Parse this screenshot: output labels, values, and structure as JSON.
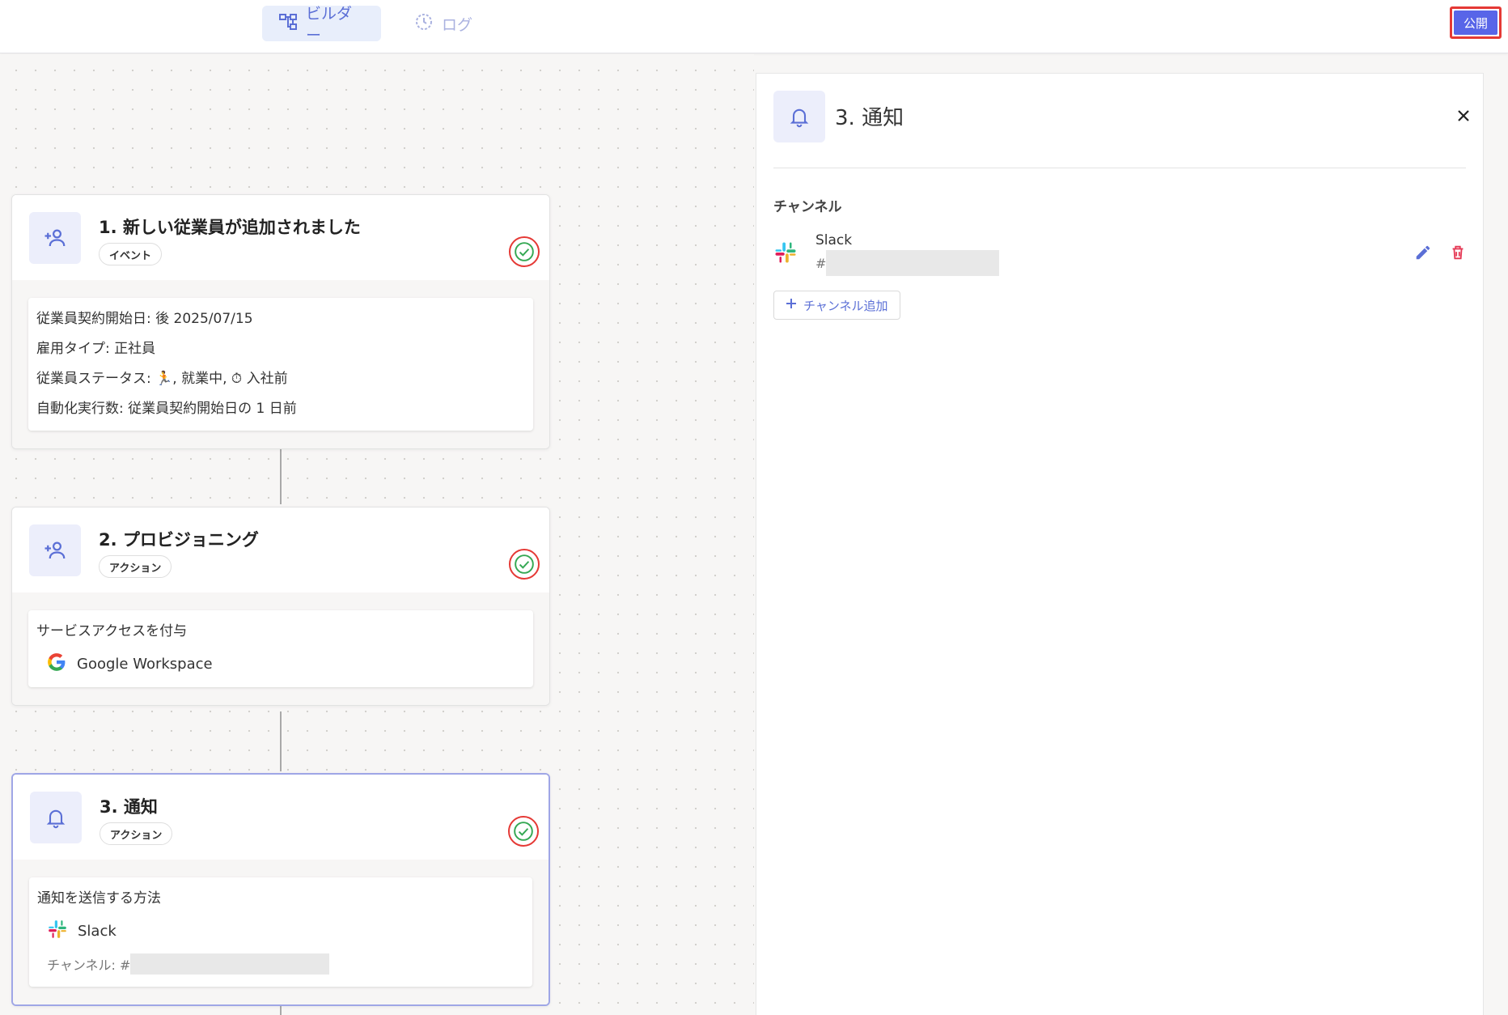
{
  "topbar": {
    "tabs": [
      {
        "label": "ビルダー",
        "icon": "workflow-icon",
        "active": true
      },
      {
        "label": "ログ",
        "icon": "history-icon",
        "active": false
      }
    ],
    "publish_label": "公開"
  },
  "nodes": [
    {
      "title": "1. 新しい従業員が追加されました",
      "badge": "イベント",
      "icon": "person-add-icon",
      "status": "check-circle-icon",
      "lines": [
        "従業員契約開始日: 後 2025/07/15",
        "雇用タイプ: 正社員",
        "従業員ステータス: 🏃, 就業中, ⏱ 入社前",
        "自動化実行数: 従業員契約開始日の 1 日前"
      ]
    },
    {
      "title": "2. プロビジョニング",
      "badge": "アクション",
      "icon": "person-add-icon",
      "status": "check-circle-icon",
      "heading": "サービスアクセスを付与",
      "service": "Google Workspace"
    },
    {
      "title": "3. 通知",
      "badge": "アクション",
      "icon": "bell-icon",
      "status": "check-circle-icon",
      "selected": true,
      "heading": "通知を送信する方法",
      "service": "Slack",
      "channel_label": "チャンネル: #"
    }
  ],
  "panel": {
    "title": "3. 通知",
    "icon": "bell-icon",
    "section_label": "チャンネル",
    "channels": [
      {
        "service": "Slack",
        "prefix": "#"
      }
    ],
    "add_channel_label": "チャンネル追加"
  },
  "colors": {
    "accent": "#5865e8",
    "accent_soft": "#eceefb",
    "success": "#34a853",
    "highlight": "#e53935",
    "delete": "#e53955"
  }
}
